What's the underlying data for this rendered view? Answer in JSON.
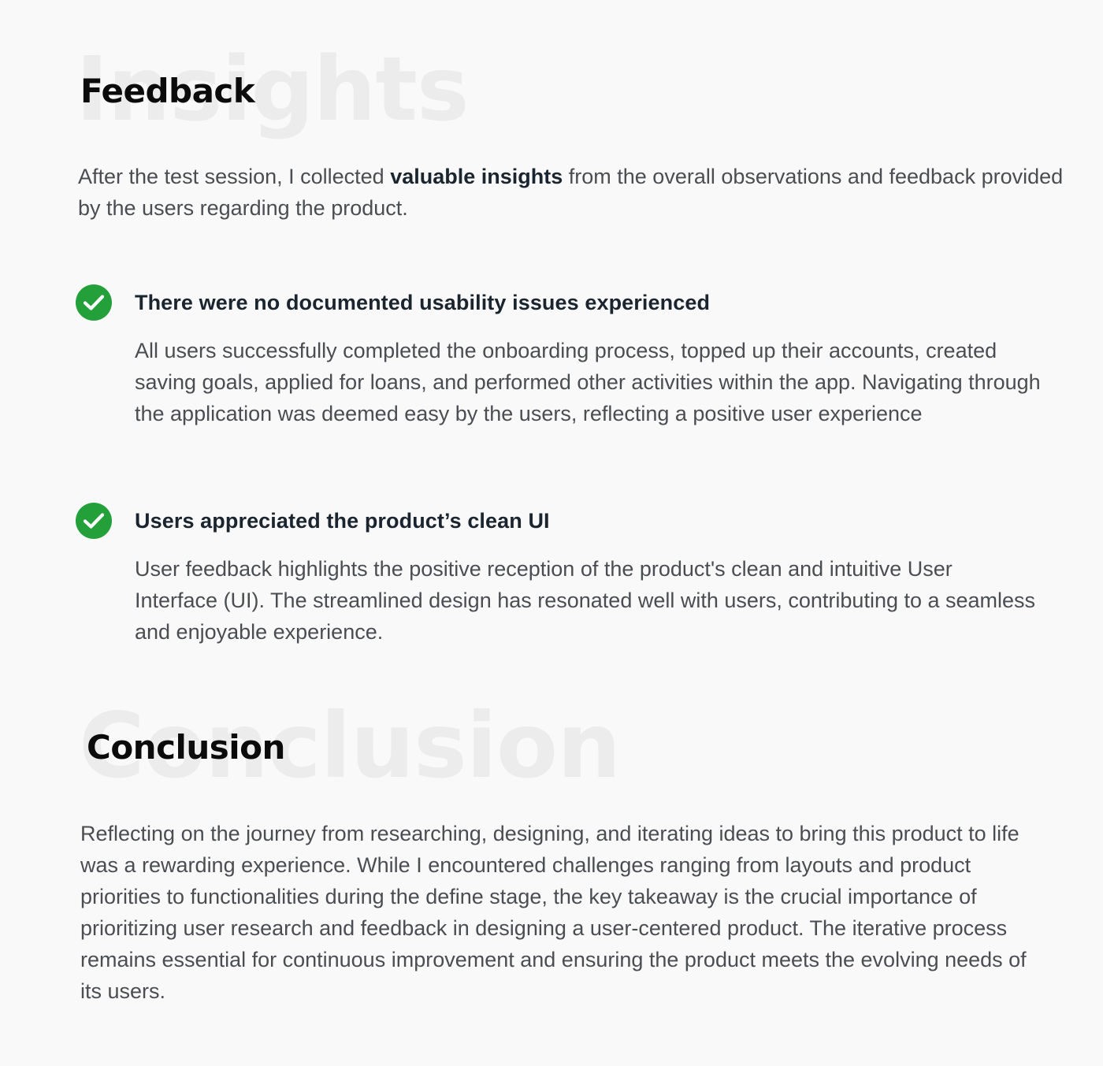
{
  "feedback": {
    "bg_word": "Insights",
    "title": "Feedback",
    "intro_before": "After the test session, I collected ",
    "intro_bold": "valuable insights",
    "intro_after": " from the overall observations and feedback provided by the users regarding the product.",
    "items": [
      {
        "icon": "check-circle-icon",
        "title": "There were no documented usability issues experienced",
        "body": "All users successfully completed the onboarding process, topped up their accounts, created saving goals, applied for loans, and performed other activities within the app. Navigating through the application was deemed easy by the users, reflecting a positive user experience"
      },
      {
        "icon": "check-circle-icon",
        "title": "Users appreciated the product’s clean UI",
        "body": "User feedback highlights the positive reception of the product's clean and intuitive User Interface (UI). The streamlined design has resonated well with users, contributing to a seamless and enjoyable experience."
      }
    ]
  },
  "conclusion": {
    "bg_word": "Conclusion",
    "title": "Conclusion",
    "body": "Reflecting on the journey from researching, designing, and iterating ideas to bring this product to life was a rewarding experience. While I encountered challenges ranging from layouts and product priorities to functionalities during the define stage, the key takeaway is the crucial importance of prioritizing user research and feedback in designing a user-centered product. The iterative process remains essential for continuous improvement and ensuring the product meets the evolving needs of its users."
  },
  "colors": {
    "background": "#f9f9f9",
    "accent_green": "#24a03a",
    "heading": "#0b0b0b",
    "body_text": "#4a4d52",
    "watermark": "#ececec"
  }
}
